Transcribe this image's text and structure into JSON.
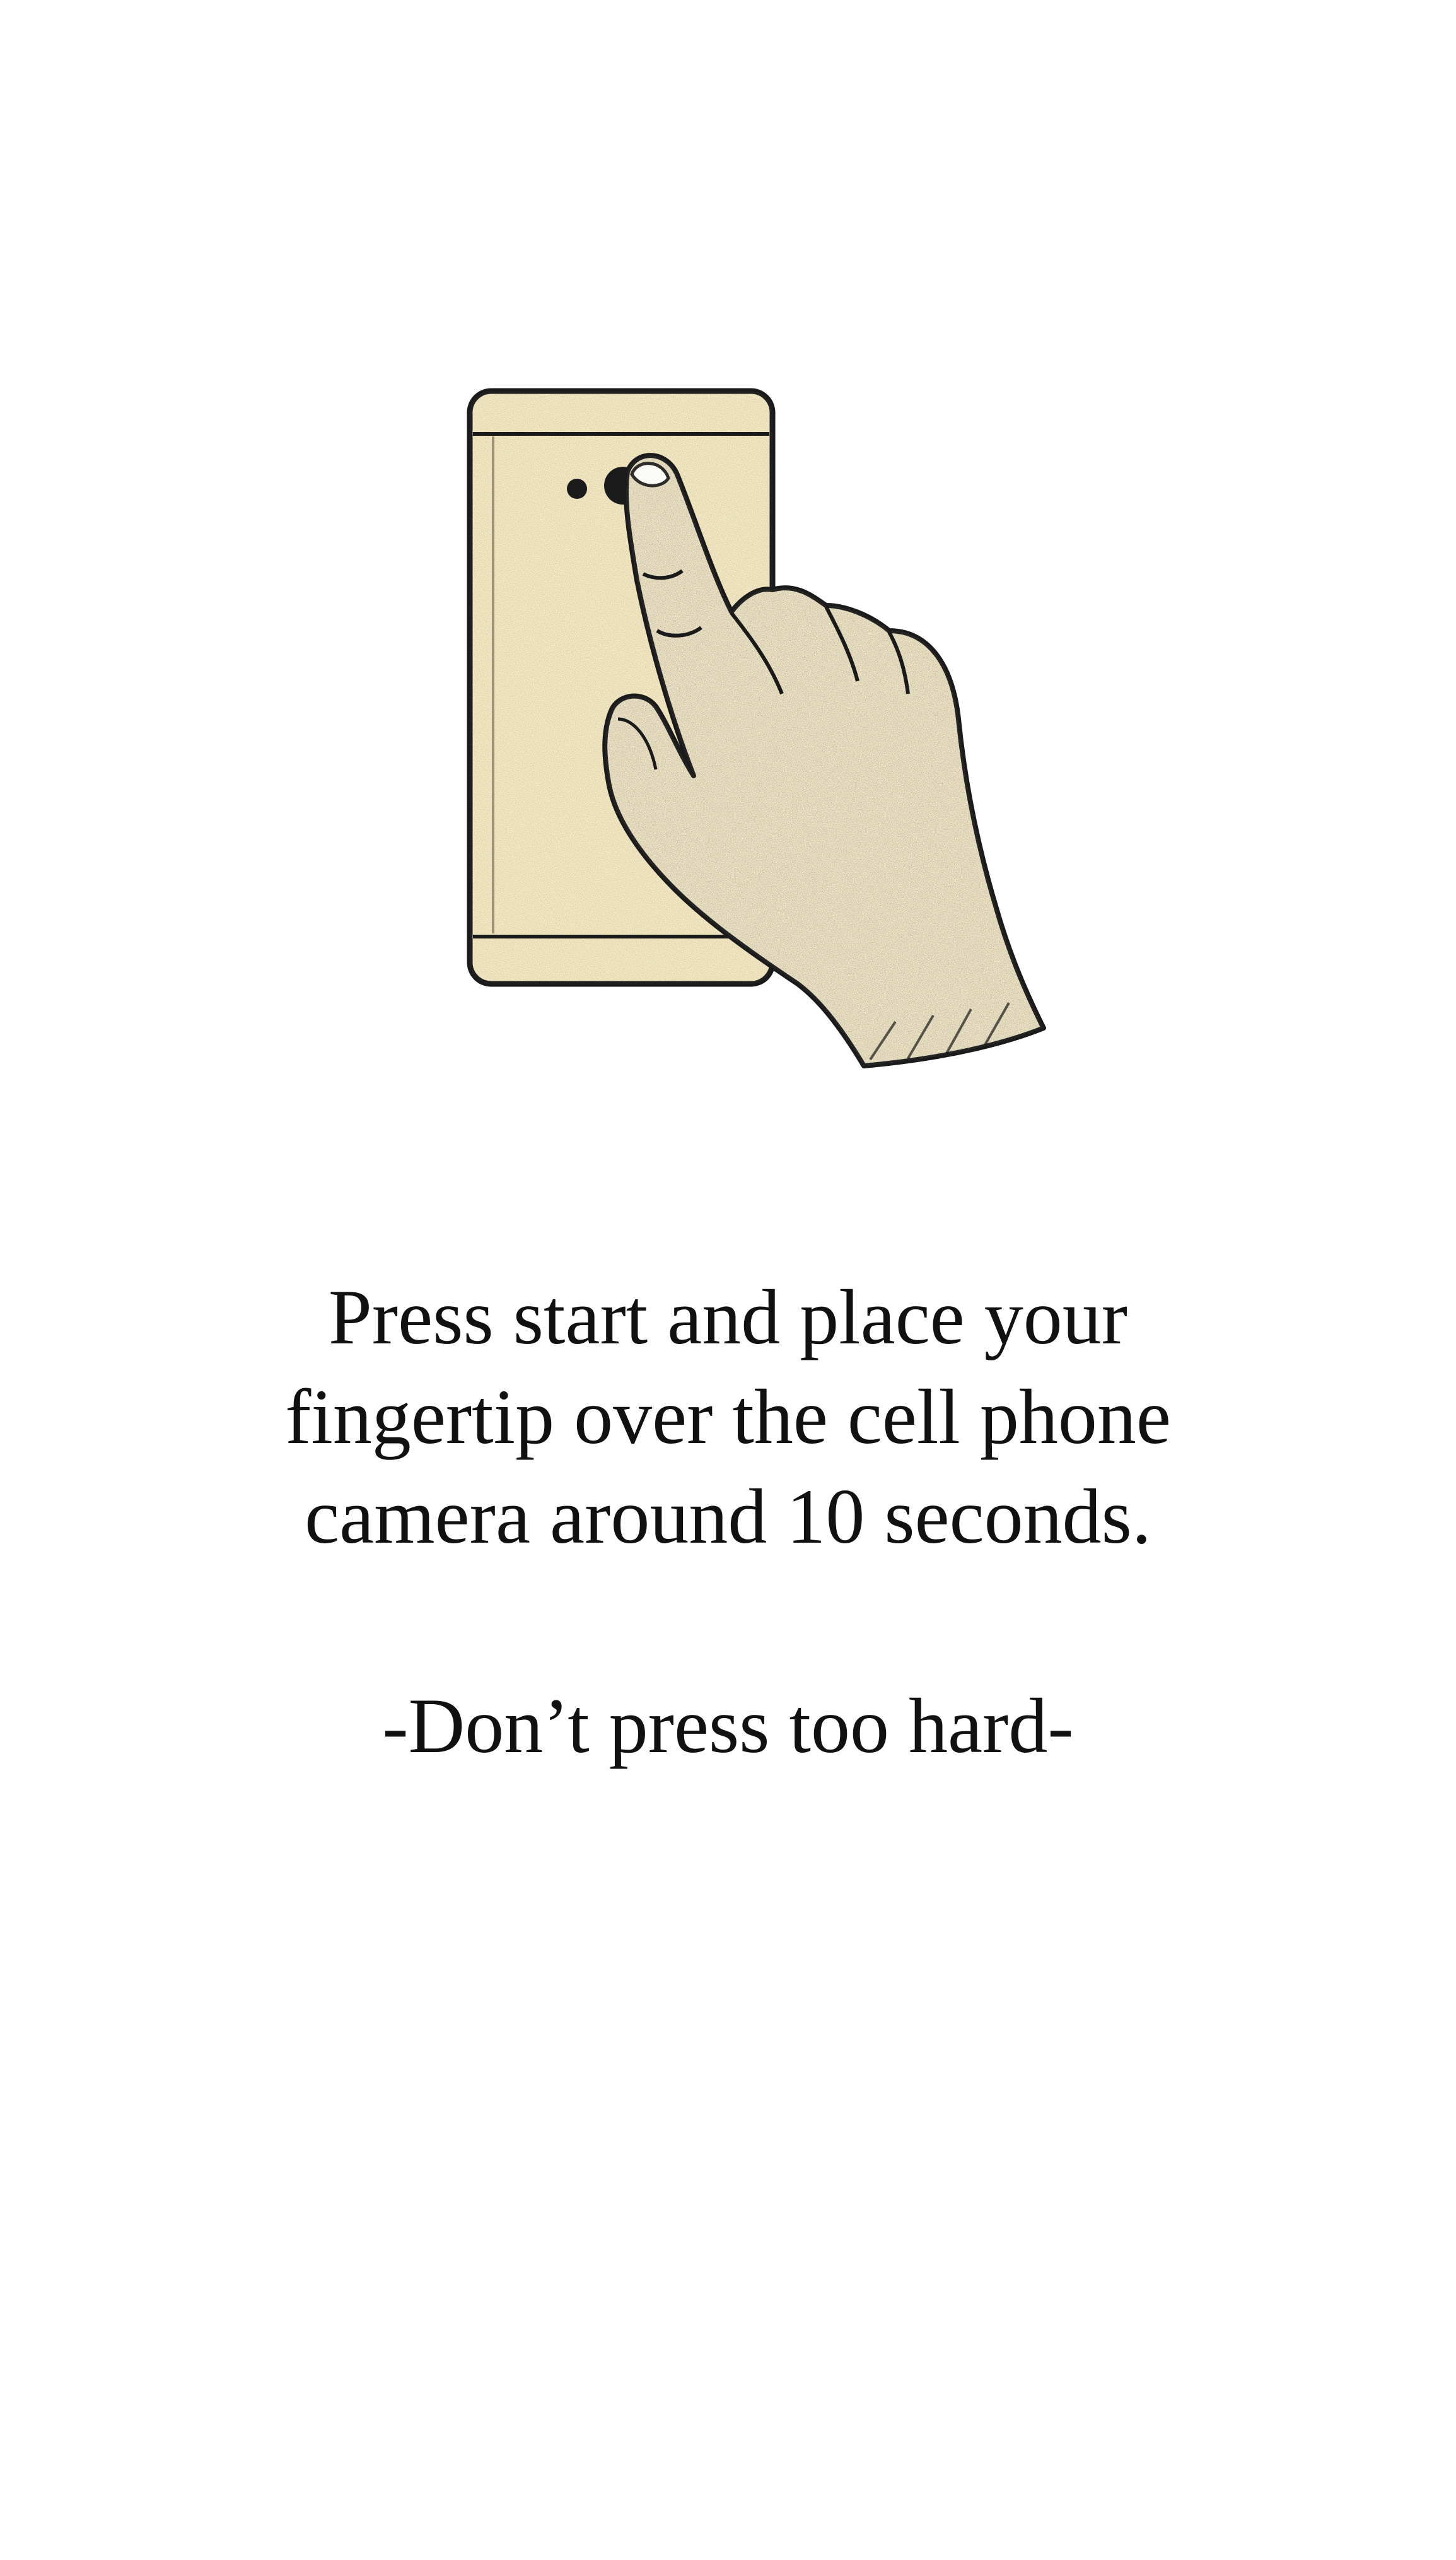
{
  "illustration": {
    "icon": "finger-on-phone-camera-icon",
    "colors": {
      "phone_fill": "#fbefc6",
      "hand_fill": "#f7eccb",
      "ink": "#1a1a1a"
    }
  },
  "instructions": {
    "lines": [
      "Press start and place your",
      "fingertip over the cell phone",
      "camera around 10 seconds."
    ]
  },
  "warning": "-Don’t press too hard-"
}
